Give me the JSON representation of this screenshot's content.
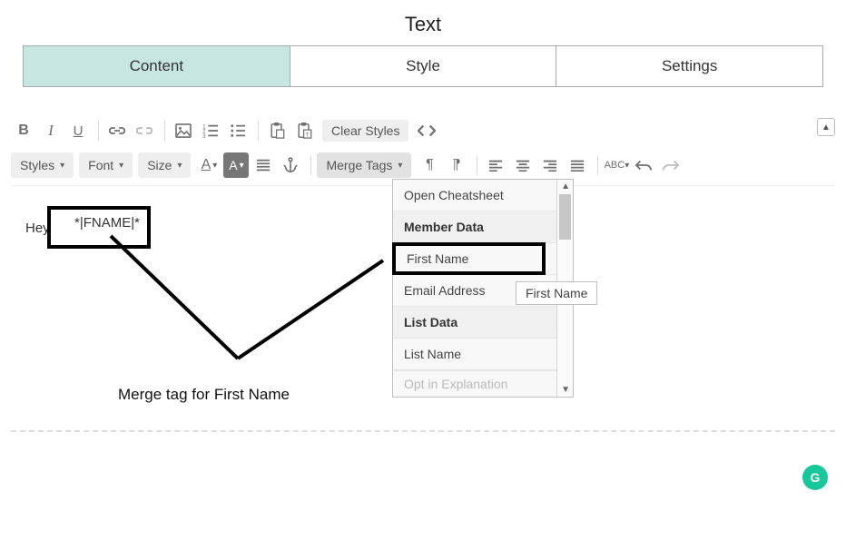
{
  "title": "Text",
  "tabs": {
    "content": "Content",
    "style": "Style",
    "settings": "Settings"
  },
  "toolbar": {
    "clear_styles": "Clear Styles",
    "styles": "Styles",
    "font": "Font",
    "size": "Size",
    "merge_tags": "Merge Tags"
  },
  "body": {
    "hey": "Hey",
    "merge_tag": "*|FNAME|*"
  },
  "dropdown": {
    "open_cheatsheet": "Open Cheatsheet",
    "member_data": "Member Data",
    "first_name": "First Name",
    "email_address": "Email Address",
    "list_data": "List Data",
    "list_name": "List Name",
    "cut": "Opt in Explanation"
  },
  "tooltip": "First Name",
  "annotation": "Merge tag for First Name",
  "grammarly": "G"
}
